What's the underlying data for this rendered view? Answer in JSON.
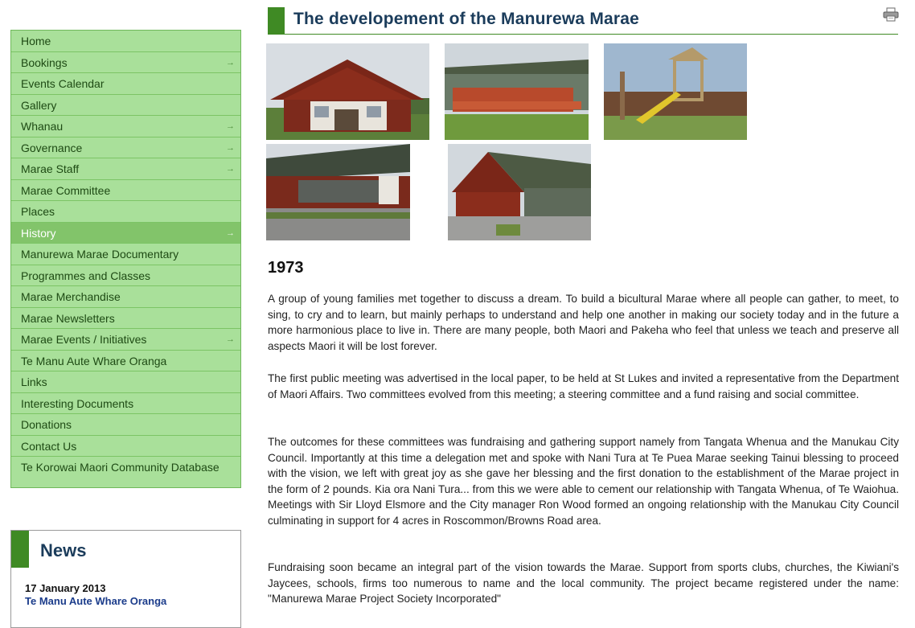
{
  "menu": {
    "items": [
      {
        "label": "Home",
        "arrow": false
      },
      {
        "label": "Bookings",
        "arrow": true
      },
      {
        "label": "Events Calendar",
        "arrow": false
      },
      {
        "label": "Gallery",
        "arrow": false
      },
      {
        "label": "Whanau",
        "arrow": true
      },
      {
        "label": "Governance",
        "arrow": true
      },
      {
        "label": "Marae Staff",
        "arrow": true
      },
      {
        "label": "Marae Committee",
        "arrow": false
      },
      {
        "label": "Places",
        "arrow": false
      },
      {
        "label": "History",
        "arrow": true,
        "active": true
      },
      {
        "label": "Manurewa Marae Documentary",
        "arrow": false
      },
      {
        "label": "Programmes and Classes",
        "arrow": false
      },
      {
        "label": "Marae Merchandise",
        "arrow": false
      },
      {
        "label": "Marae Newsletters",
        "arrow": false
      },
      {
        "label": "Marae Events / Initiatives",
        "arrow": true
      },
      {
        "label": "Te Manu Aute Whare Oranga",
        "arrow": false
      },
      {
        "label": "Links",
        "arrow": false
      },
      {
        "label": "Interesting Documents",
        "arrow": false
      },
      {
        "label": "Donations",
        "arrow": false
      },
      {
        "label": "Contact Us",
        "arrow": false
      },
      {
        "label": "Te Korowai Maori Community Database",
        "arrow": false
      }
    ],
    "arrow_glyph": "→"
  },
  "news": {
    "title": "News",
    "date": "17 January 2013",
    "link": "Te Manu Aute Whare Oranga"
  },
  "main": {
    "title": "The developement of the Manurewa Marae",
    "print_icon": "printer-icon",
    "photos": [
      "marae-front",
      "marae-deck",
      "playground",
      "marae-side",
      "marae-corner"
    ],
    "year": "1973",
    "paragraphs": [
      "A group of young families met together to discuss a dream. To build a bicultural Marae where all people can gather, to meet, to sing, to cry and to learn, but mainly perhaps to understand and help one another in making our society today and in the future a more harmonious place to live in. There are many people, both Maori and Pakeha who feel that unless we teach and preserve all aspects Maori it will be lost forever.",
      "The first public meeting was advertised in the local paper, to be held at St Lukes and invited a representative from the Department of Maori Affairs. Two committees evolved from this meeting; a steering committee and a fund raising and social committee.",
      "The outcomes for these committees was fundraising and gathering support namely from Tangata Whenua and the Manukau City Council. Importantly at this time a delegation met and spoke with Nani Tura at Te Puea Marae seeking Tainui blessing to proceed with the vision, we left with great joy as she gave her blessing and the first donation to the establishment of the Marae project in the form of 2 pounds. Kia ora Nani Tura... from this we were able to cement our relationship with Tangata Whenua, of Te Waiohua. Meetings with Sir Lloyd Elsmore and the City manager Ron Wood formed an ongoing relationship with the Manukau City Council culminating in support for 4 acres in Roscommon/Browns Road area.",
      "Fundraising soon became an integral part of the vision towards the Marae. Support from sports clubs, churches, the Kiwiani's Jaycees, schools, firms too numerous to name and the local community. The project became registered under the name: \"Manurewa Marae Project Society Incorporated\""
    ]
  },
  "colors": {
    "menu_bg": "#a9e09a",
    "menu_active": "#82c46a",
    "accent_green": "#3f8a24",
    "heading_blue": "#1b3c5b"
  }
}
